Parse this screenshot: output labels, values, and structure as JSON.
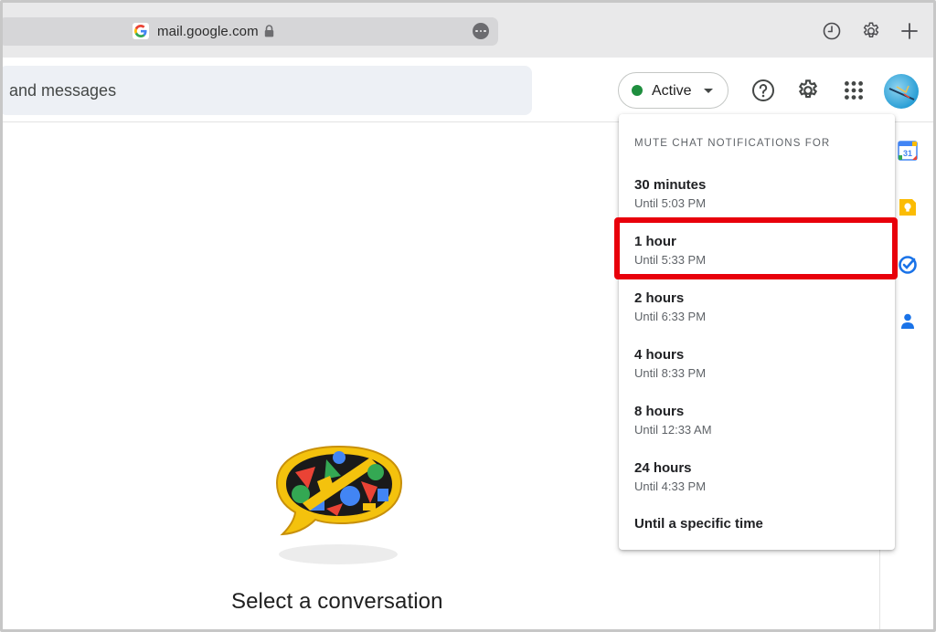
{
  "browser": {
    "url": "mail.google.com",
    "icons": [
      "g-favicon-icon",
      "lock-icon",
      "more-icon",
      "history-icon",
      "gear-icon",
      "plus-icon"
    ]
  },
  "header": {
    "search_text": "and messages",
    "status_label": "Active",
    "status_color": "#1e8e3e",
    "icons": [
      "help-icon",
      "settings-icon",
      "apps-grid-icon",
      "avatar"
    ]
  },
  "menu": {
    "heading": "MUTE CHAT NOTIFICATIONS FOR",
    "items": [
      {
        "label": "30 minutes",
        "sub": "Until 5:03 PM"
      },
      {
        "label": "1 hour",
        "sub": "Until 5:33 PM"
      },
      {
        "label": "2 hours",
        "sub": "Until 6:33 PM"
      },
      {
        "label": "4 hours",
        "sub": "Until 8:33 PM"
      },
      {
        "label": "8 hours",
        "sub": "Until 12:33 AM"
      },
      {
        "label": "24 hours",
        "sub": "Until 4:33 PM"
      },
      {
        "label": "Until a specific time"
      }
    ],
    "highlight_color": "#e8000b"
  },
  "side_panel": {
    "calendar_day": "31",
    "icons": [
      "calendar-icon",
      "keep-icon",
      "tasks-icon",
      "contacts-icon"
    ]
  },
  "main": {
    "empty_title": "Select a conversation"
  }
}
